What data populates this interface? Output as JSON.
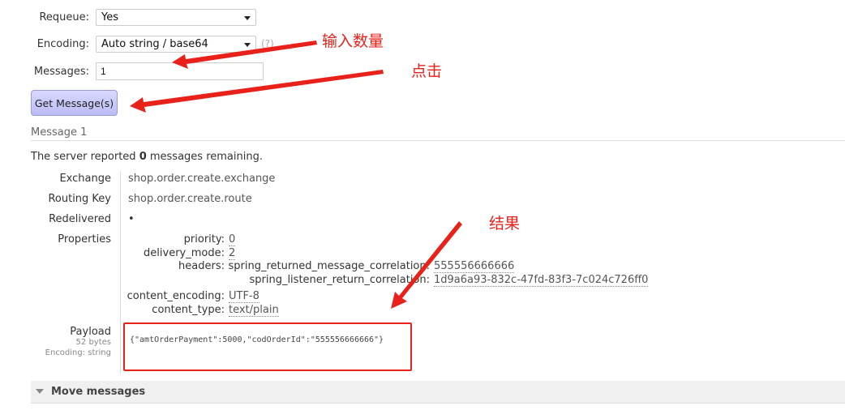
{
  "form": {
    "requeue_label": "Requeue:",
    "requeue_value": "Yes",
    "encoding_label": "Encoding:",
    "encoding_value": "Auto string / base64",
    "encoding_help": "(?)",
    "messages_label": "Messages:",
    "messages_value": "1",
    "get_button": "Get Message(s)"
  },
  "message": {
    "heading": "Message 1",
    "remaining_pre": "The server reported ",
    "remaining_count": "0",
    "remaining_post": " messages remaining.",
    "exchange_label": "Exchange",
    "exchange": "shop.order.create.exchange",
    "routing_label": "Routing Key",
    "routing_key": "shop.order.create.route",
    "redelivered_label": "Redelivered",
    "redelivered": "•",
    "properties_label": "Properties",
    "props": {
      "priority_k": "priority:",
      "priority": "0",
      "delivery_k": "delivery_mode:",
      "delivery_mode": "2",
      "headers_k": "headers:",
      "h1_k": "spring_returned_message_correlation:",
      "h1": "555556666666",
      "h2_k": "spring_listener_return_correlation:",
      "h2": "1d9a6a93-832c-47fd-83f3-7c024c726ff0",
      "ce_k": "content_encoding:",
      "content_encoding": "UTF-8",
      "ct_k": "content_type:",
      "content_type": "text/plain"
    },
    "payload_label": "Payload",
    "payload_size": "52 bytes",
    "payload_encoding": "Encoding: string",
    "payload": "{\"amtOrderPayment\":5000,\"codOrderId\":\"555556666666\"}"
  },
  "move_messages": "Move messages",
  "annotations": {
    "input_count": "输入数量",
    "click": "点击",
    "result": "结果",
    "color": "#e8221b"
  }
}
